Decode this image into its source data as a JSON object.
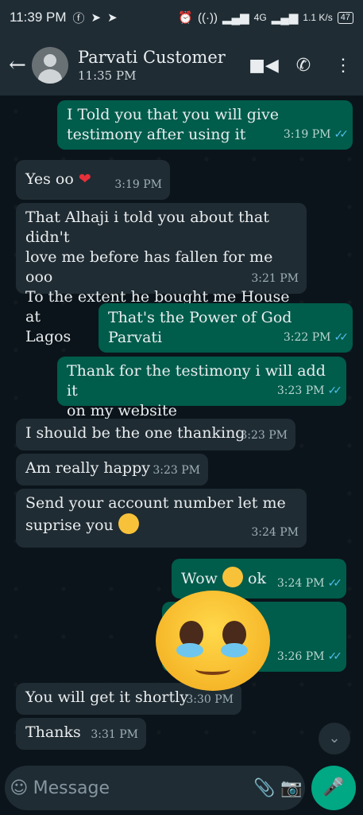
{
  "status_bar": {
    "time": "11:39 PM",
    "network": "4G",
    "speed": "1.1 K/s",
    "battery": "47"
  },
  "header": {
    "contact_name": "Parvati Customer",
    "last_seen": "11:35 PM"
  },
  "messages": [
    {
      "dir": "out",
      "text": "I Told you that you will give\ntestimony after using it",
      "time": "3:19 PM"
    },
    {
      "dir": "in",
      "text": "Yes oo ",
      "emoji": "heart",
      "time": "3:19 PM"
    },
    {
      "dir": "in",
      "text": "That Alhaji i told you about that didn't\nlove me before has fallen for me ooo\nTo the extent he bought me House at\nLagos",
      "time": "3:21 PM"
    },
    {
      "dir": "out",
      "text": "That's the Power of God Parvati",
      "time": "3:22 PM"
    },
    {
      "dir": "out",
      "text": "Thank for the testimony i will add it\non my website",
      "time": "3:23 PM"
    },
    {
      "dir": "in",
      "text": "I should be the one thanking",
      "time": "3:23 PM"
    },
    {
      "dir": "in",
      "text": "Am really happy",
      "time": "3:23 PM"
    },
    {
      "dir": "in",
      "text": "Send your account number let me\nsuprise you ",
      "emoji": "smile",
      "time": "3:24 PM"
    },
    {
      "dir": "out",
      "text": "Wow ",
      "emoji": "flushed",
      "text_after": " ok",
      "time": "3:24 PM"
    },
    {
      "dir": "out",
      "text": "",
      "time": "3:26 PM"
    },
    {
      "dir": "in",
      "text": "You will get it shortly",
      "time": "3:30 PM"
    },
    {
      "dir": "in",
      "text": "Thanks",
      "time": "3:31 PM"
    }
  ],
  "composer": {
    "placeholder": "Message"
  },
  "colors": {
    "incoming": "#202c33",
    "outgoing": "#005c4b",
    "accent": "#00a884",
    "read_ticks": "#53bdeb"
  }
}
